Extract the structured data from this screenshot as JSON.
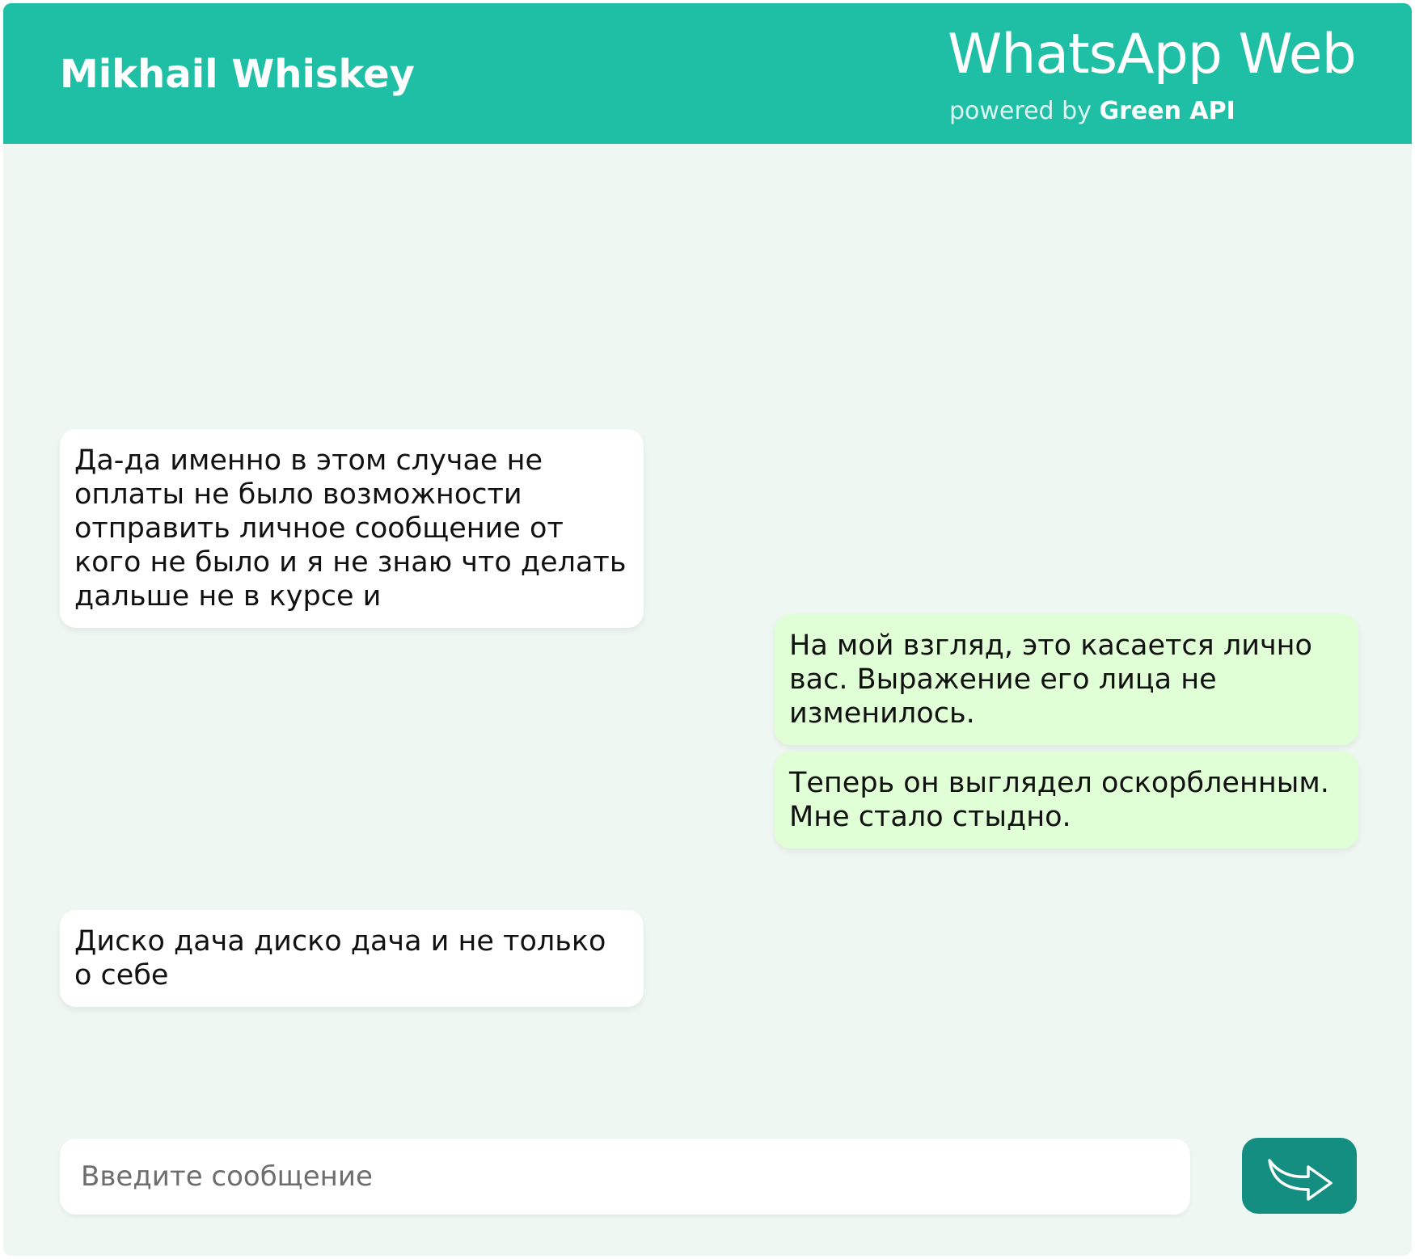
{
  "header": {
    "contact_name": "Mikhail Whiskey",
    "brand_title": "WhatsApp Web",
    "brand_powered_by": "powered by",
    "brand_provider": "Green API"
  },
  "messages": [
    {
      "direction": "incoming",
      "text": "Да-да именно в этом случае не оплаты не было возможности отправить личное сообщение от кого не было и я не знаю что делать дальше не в курсе и"
    },
    {
      "direction": "outgoing",
      "text": "На мой взгляд, это касается лично вас. Выражение его лица не изменилось."
    },
    {
      "direction": "outgoing",
      "text": "Теперь он выглядел оскорбленным. Мне стало стыдно."
    },
    {
      "direction": "incoming",
      "text": "Диско дача диско дача и не только о себе"
    }
  ],
  "composer": {
    "placeholder": "Введите сообщение",
    "value": ""
  },
  "send_button": {
    "icon": "send-arrow-icon"
  },
  "colors": {
    "header": "#1fbfa6",
    "background": "#eef7f2",
    "incoming_bubble": "#ffffff",
    "outgoing_bubble": "#e0ffd6",
    "send_button": "#138e80"
  }
}
